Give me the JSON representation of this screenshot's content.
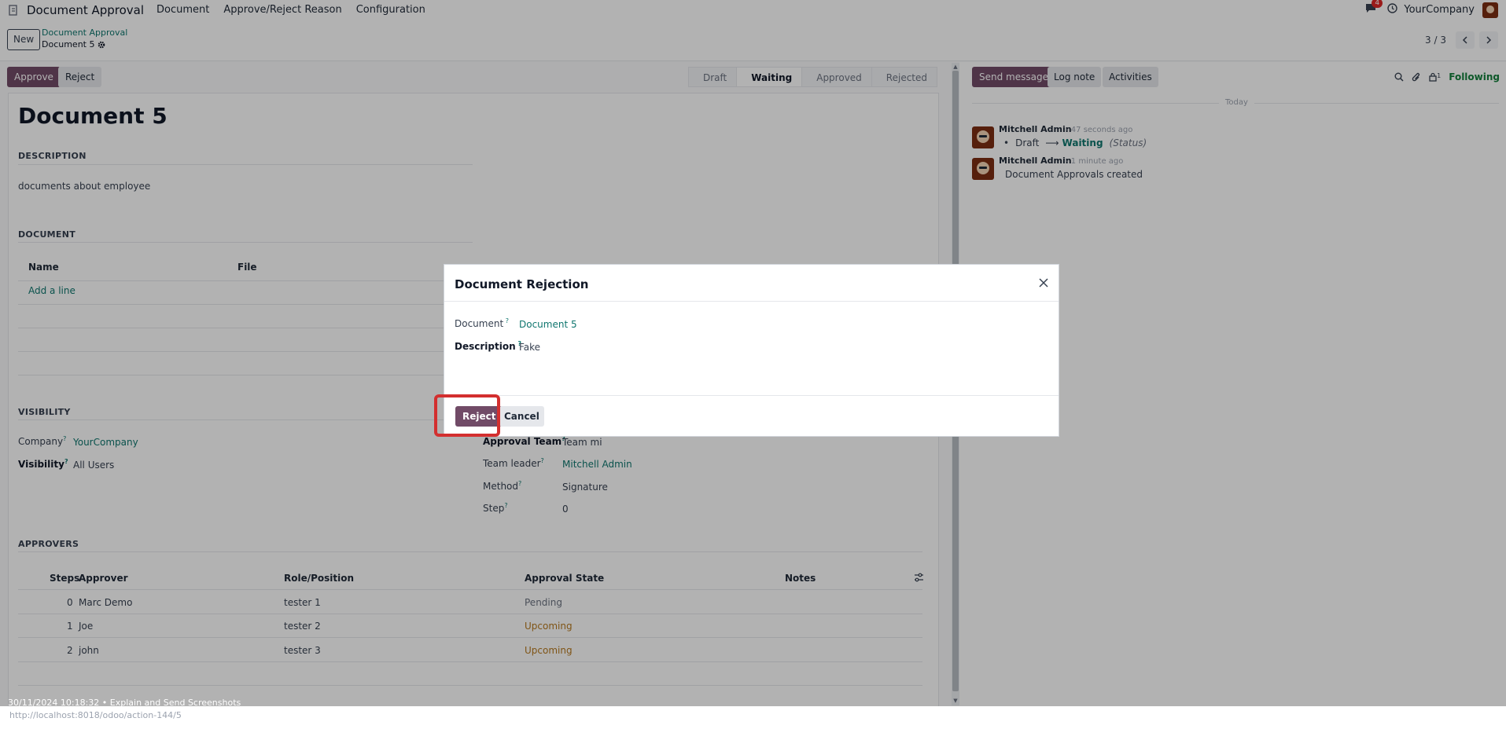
{
  "navbar": {
    "app_title": "Document Approval",
    "menus": [
      "Document",
      "Approve/Reject Reason",
      "Configuration"
    ],
    "notification_count": "4",
    "company": "YourCompany"
  },
  "control_panel": {
    "new_label": "New",
    "breadcrumb_parent": "Document Approval",
    "breadcrumb_current": "Document 5",
    "pager": "3 / 3"
  },
  "statusbar": {
    "approve_label": "Approve",
    "reject_label": "Reject",
    "stages": [
      "Draft",
      "Waiting",
      "Approved",
      "Rejected"
    ],
    "active_stage": "Waiting"
  },
  "form": {
    "title": "Document 5",
    "description_header": "DESCRIPTION",
    "description_text": "documents about employee",
    "document_header": "DOCUMENT",
    "document_columns": [
      "Name",
      "File"
    ],
    "add_line": "Add a line",
    "visibility_header": "VISIBILITY",
    "company_label": "Company",
    "company_value": "YourCompany",
    "visibility_label": "Visibility",
    "visibility_value": "All Users",
    "approval_team_label": "Approval Team",
    "approval_team_value": "Team mi",
    "team_leader_label": "Team leader",
    "team_leader_value": "Mitchell Admin",
    "method_label": "Method",
    "method_value": "Signature",
    "step_label": "Step",
    "step_value": "0",
    "approvers_header": "APPROVERS",
    "approvers_columns": [
      "Steps",
      "Approver",
      "Role/Position",
      "Approval State",
      "Notes"
    ],
    "approvers_rows": [
      {
        "step": "0",
        "approver": "Marc Demo",
        "role": "tester 1",
        "state": "Pending"
      },
      {
        "step": "1",
        "approver": "Joe",
        "role": "tester 2",
        "state": "Upcoming"
      },
      {
        "step": "2",
        "approver": "john",
        "role": "tester 3",
        "state": "Upcoming"
      }
    ]
  },
  "chatter": {
    "send_message": "Send message",
    "log_note": "Log note",
    "activities": "Activities",
    "followers_count": "1",
    "following": "Following",
    "day": "Today",
    "messages": [
      {
        "author": "Mitchell Admin",
        "time": "- 47 seconds ago",
        "from": "Draft",
        "to": "Waiting",
        "field": "(Status)"
      },
      {
        "author": "Mitchell Admin",
        "time": "- 1 minute ago",
        "body": "Document Approvals created"
      }
    ]
  },
  "dialog": {
    "title": "Document Rejection",
    "document_label": "Document",
    "document_value": "Document 5",
    "description_label": "Description",
    "description_value": "Fake",
    "reject_label": "Reject",
    "cancel_label": "Cancel"
  },
  "footer": {
    "recording": "30/11/2024 10:18:32 • Explain and Send Screenshots",
    "url": "http://localhost:8018/odoo/action-144/5"
  },
  "colors": {
    "primary": "#714b67",
    "link": "#0f766e",
    "upcoming": "#b7791f",
    "following": "#15803d",
    "highlight": "#d32f2f"
  }
}
